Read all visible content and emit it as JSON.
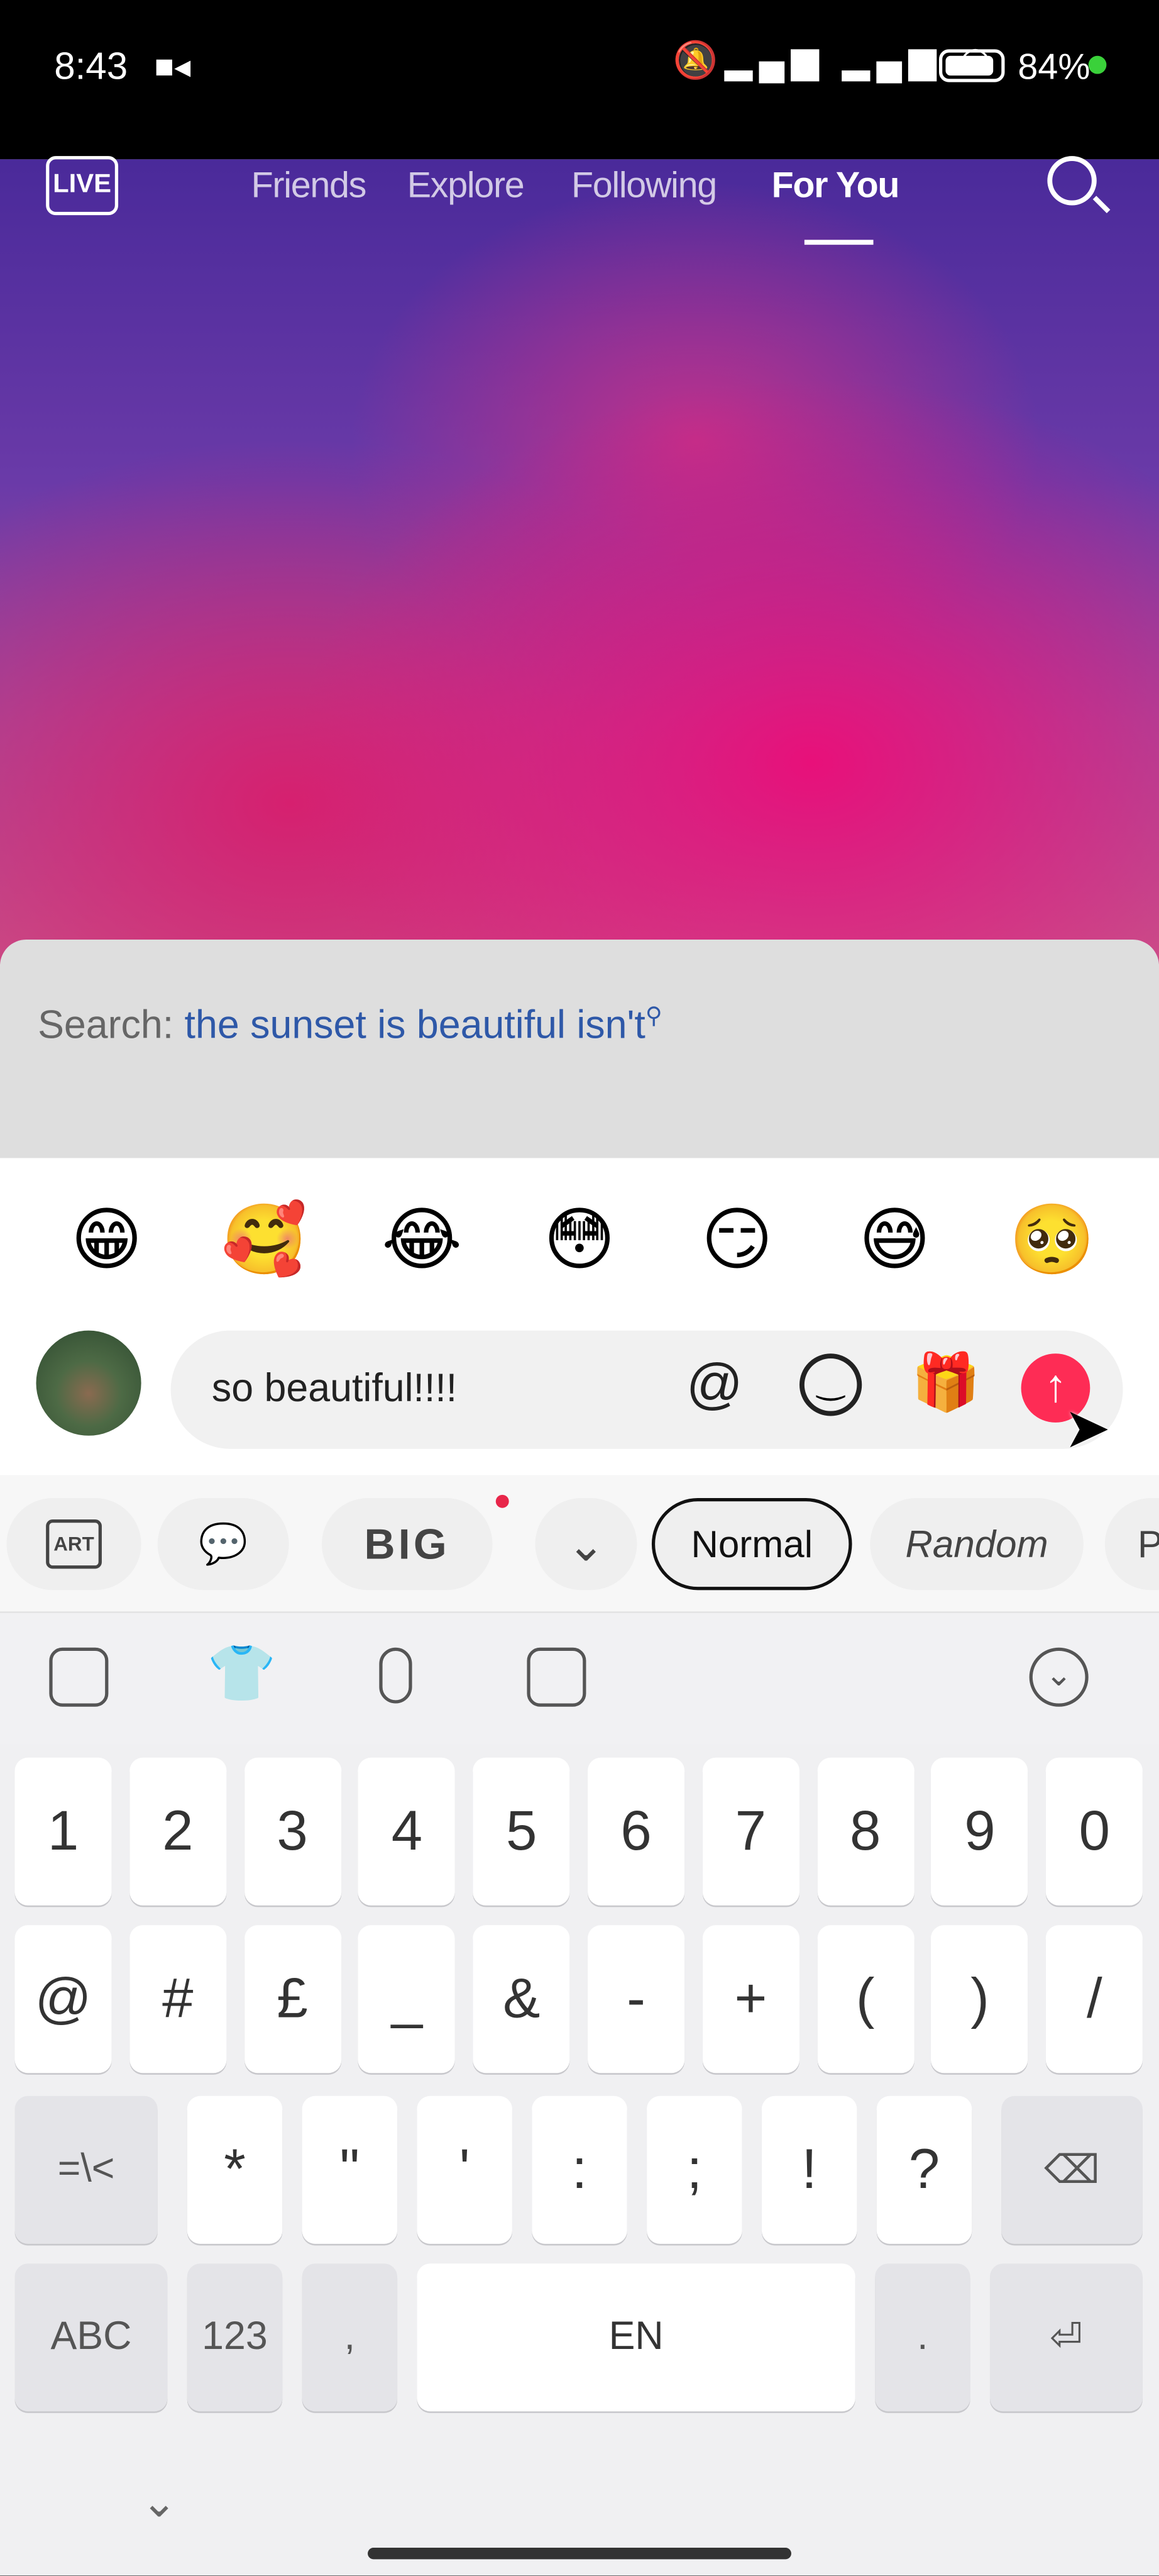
{
  "status_bar": {
    "time": "8:43",
    "battery": "84"
  },
  "top_nav": {
    "live_label": "LIVE",
    "tabs": [
      {
        "label": "Friends"
      },
      {
        "label": "Explore"
      },
      {
        "label": "Following"
      },
      {
        "label": "For You",
        "active": true
      }
    ]
  },
  "search_suggestion": {
    "prefix": "Search:",
    "query": "the sunset is beautiful isn't"
  },
  "emojis": [
    "😁",
    "🥰",
    "😂",
    "😳",
    "😏",
    "😅",
    "🥺"
  ],
  "comment_input": {
    "value": "so beautiful!!!!",
    "mention": "@",
    "accent": "#fe2c55"
  },
  "font_styles": {
    "art": "ART",
    "big": "BIG",
    "options": [
      "Normal",
      "Random",
      "P"
    ],
    "selected": "Normal"
  },
  "keyboard": {
    "row1": [
      "1",
      "2",
      "3",
      "4",
      "5",
      "6",
      "7",
      "8",
      "9",
      "0"
    ],
    "row2": [
      "@",
      "#",
      "£",
      "_",
      "&",
      "-",
      "+",
      "(",
      ")",
      "/"
    ],
    "row3_mod": "=\\<",
    "row3": [
      "*",
      "\"",
      "'",
      ":",
      ";",
      "!",
      "?"
    ],
    "row4": {
      "abc": "ABC",
      "num": "123",
      "comma": ",",
      "space": "EN",
      "period": "."
    }
  }
}
